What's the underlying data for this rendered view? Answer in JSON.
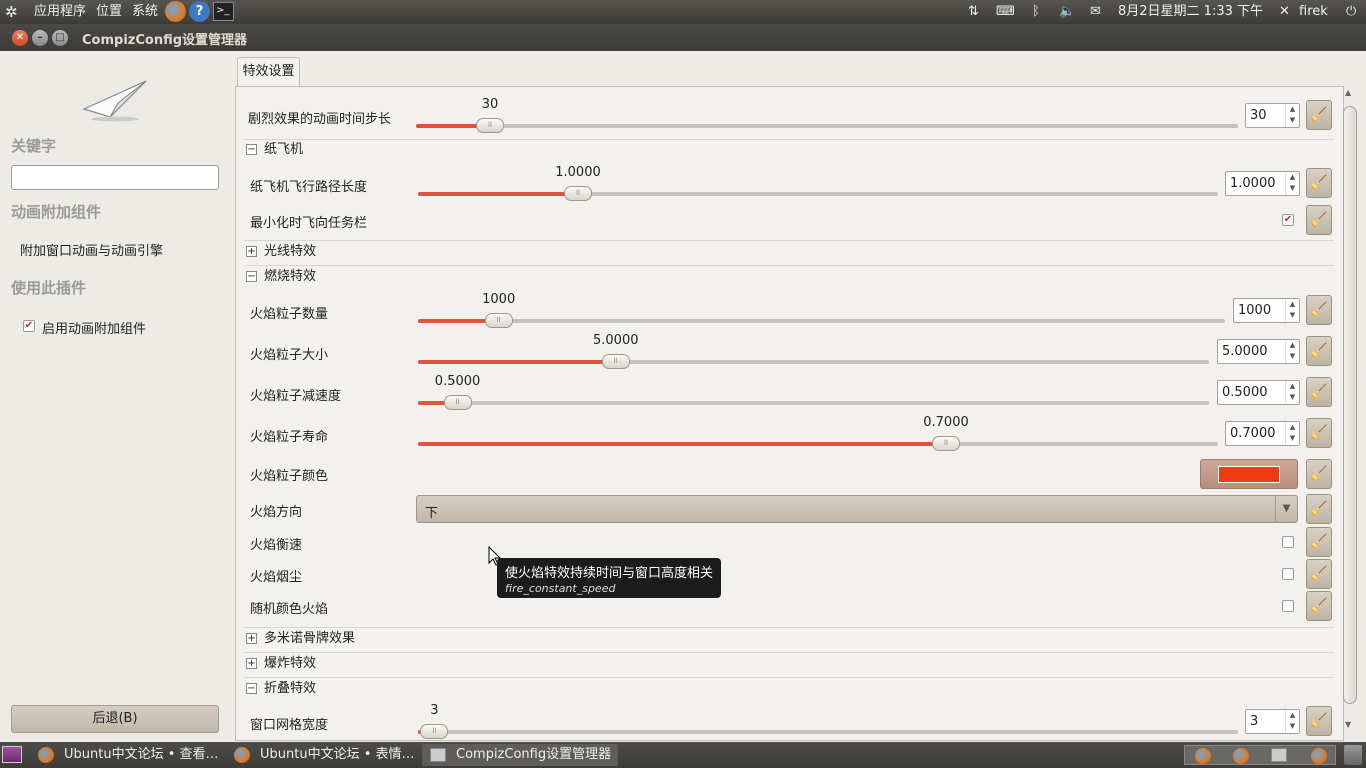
{
  "panel": {
    "menus": [
      "应用程序",
      "位置",
      "系统"
    ],
    "datetime": "8月2日星期二  1:33 下午",
    "user": "firek"
  },
  "window": {
    "title": "CompizConfig设置管理器"
  },
  "sidebar": {
    "keyword_heading": "关键字",
    "search_value": "",
    "plugin_heading": "动画附加组件",
    "plugin_desc": "附加窗口动画与动画引擎",
    "use_heading": "使用此插件",
    "enable_label": "启用动画附加组件",
    "back_label": "后退(B)"
  },
  "tab": {
    "label": "特效设置"
  },
  "settings": {
    "intense_step": {
      "label": "剧烈效果的动画时间步长",
      "value": "30",
      "fraction": 0.09
    },
    "airplane": {
      "header": "纸飞机",
      "path_label": "纸飞机飞行路径长度",
      "path_value": "1.0000",
      "path_fraction": 0.2,
      "minimize_label": "最小化时飞向任务栏",
      "minimize_checked": true
    },
    "beam": {
      "header": "光线特效"
    },
    "burn": {
      "header": "燃烧特效",
      "particles": {
        "label": "火焰粒子数量",
        "value": "1000",
        "fraction": 0.1
      },
      "size": {
        "label": "火焰粒子大小",
        "value": "5.0000",
        "fraction": 0.25
      },
      "slowdown": {
        "label": "火焰粒子减速度",
        "value": "0.5000",
        "fraction": 0.05
      },
      "life": {
        "label": "火焰粒子寿命",
        "value": "0.7000",
        "fraction": 0.66
      },
      "color": {
        "label": "火焰粒子颜色",
        "value": "#f03a12"
      },
      "direction": {
        "label": "火焰方向",
        "value": "下"
      },
      "constant_speed": {
        "label": "火焰衡速"
      },
      "smoke": {
        "label": "火焰烟尘"
      },
      "random": {
        "label": "随机颜色火焰"
      }
    },
    "domino": {
      "header": "多米诺骨牌效果"
    },
    "explode": {
      "header": "爆炸特效"
    },
    "fold": {
      "header": "折叠特效",
      "grid_label": "窗口网格宽度",
      "grid_value": "3",
      "grid_fraction": 0.02
    }
  },
  "tooltip": {
    "text": "使火焰特效持续时间与窗口高度相关",
    "key": "fire_constant_speed"
  },
  "taskbar": {
    "tasks": [
      "Ubuntu中文论坛 • 查看…",
      "Ubuntu中文论坛 • 表情…",
      "CompizConfig设置管理器"
    ]
  }
}
